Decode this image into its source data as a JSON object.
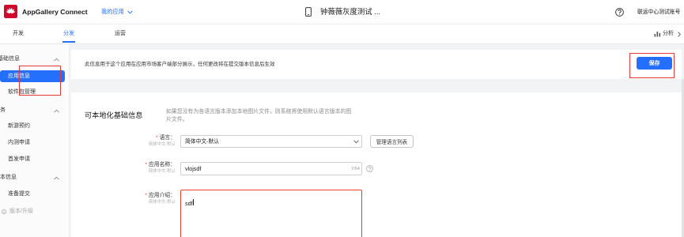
{
  "header": {
    "brand": "AppGallery Connect",
    "my_apps": "我的应用",
    "app_name": "钟薇薇灰度测试 ...",
    "account": "联运中心测试账号"
  },
  "tabs": {
    "items": [
      {
        "label": "开发",
        "active": false
      },
      {
        "label": "分发",
        "active": true
      },
      {
        "label": "运营",
        "active": false
      }
    ],
    "analysis": "分析"
  },
  "sidebar": {
    "groups": [
      {
        "title": "基础信息",
        "expanded": true,
        "items": [
          {
            "label": "应用信息",
            "selected": true
          },
          {
            "label": "软件包管理",
            "selected": false
          }
        ]
      },
      {
        "title": "务",
        "expanded": true,
        "items": [
          {
            "label": "新游预约"
          },
          {
            "label": "内测申请"
          },
          {
            "label": "首发申请"
          }
        ]
      },
      {
        "title": "本信息",
        "expanded": true,
        "items": [
          {
            "label": "准备提交"
          },
          {
            "label": "版本/升级",
            "disabled": true
          }
        ]
      }
    ]
  },
  "notice": {
    "text": "此信息用于这个应用在应用市场客户端部分展示，任何更改将在提交版本信息后生效",
    "save_label": "保存"
  },
  "card": {
    "title": "可本地化基础信息",
    "description": "如果您没有为各语言版本添加本地图片文件，则系统将使用默认语言版本的图片文件。"
  },
  "form": {
    "required_mark": "*",
    "language": {
      "label": "语言：",
      "sub": "简体中文-默认",
      "value": "简体中文-默认",
      "manage_button": "管理语言列表"
    },
    "app_name": {
      "label": "应用名称：",
      "sub": "简体中文-默认",
      "value": "vlojsdf",
      "counter": "7/64"
    },
    "app_intro": {
      "label": "应用介绍：",
      "sub": "简体中文-默认",
      "value": "sdf",
      "invalid": true
    }
  },
  "icons": [
    "huawei-logo",
    "chevron-down-icon",
    "phone-icon",
    "help-icon",
    "analysis-icon",
    "chevron-right-icon",
    "chevron-up-icon",
    "upgrade-icon"
  ],
  "colors": {
    "brand_blue": "#256fff",
    "logo_red": "#cf0a2c",
    "error_red": "#e84026",
    "annotation_red": "#e53935"
  }
}
